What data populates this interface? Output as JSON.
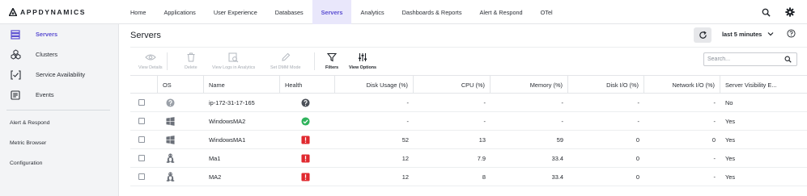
{
  "brand": {
    "name": "APPDYNAMICS"
  },
  "nav": {
    "items": [
      {
        "label": "Home",
        "active": false
      },
      {
        "label": "Applications",
        "active": false
      },
      {
        "label": "User Experience",
        "active": false
      },
      {
        "label": "Databases",
        "active": false
      },
      {
        "label": "Servers",
        "active": true
      },
      {
        "label": "Analytics",
        "active": false
      },
      {
        "label": "Dashboards & Reports",
        "active": false
      },
      {
        "label": "Alert & Respond",
        "active": false
      },
      {
        "label": "OTel",
        "active": false
      }
    ],
    "right_icons": [
      "search-icon",
      "gear-icon"
    ]
  },
  "sidebar": {
    "items": [
      {
        "label": "Servers",
        "icon": "server-stack-icon",
        "active": true
      },
      {
        "label": "Clusters",
        "icon": "cluster-icon",
        "active": false
      },
      {
        "label": "Service Availability",
        "icon": "service-check-icon",
        "active": false
      },
      {
        "label": "Events",
        "icon": "events-icon",
        "active": false
      }
    ],
    "links": [
      {
        "label": "Alert & Respond"
      },
      {
        "label": "Metric Browser"
      },
      {
        "label": "Configuration"
      }
    ]
  },
  "header": {
    "title": "Servers",
    "time_range": "last 5 minutes",
    "accent": "#5b4ed1"
  },
  "toolbar": {
    "tools": [
      {
        "label": "View Details",
        "icon": "eye-icon",
        "enabled": false
      },
      {
        "label": "Delete",
        "icon": "trash-icon",
        "enabled": false
      },
      {
        "label": "View Logs in Analytics",
        "icon": "logs-search-icon",
        "enabled": false
      },
      {
        "label": "Set DMM Mode",
        "icon": "pencil-icon",
        "enabled": false
      },
      {
        "label": "Filters",
        "icon": "filter-icon",
        "enabled": true
      },
      {
        "label": "View Options",
        "icon": "sliders-icon",
        "enabled": true
      }
    ],
    "search_placeholder": "Search..."
  },
  "table": {
    "columns": [
      "OS",
      "Name",
      "Health",
      "Disk Usage (%)",
      "CPU (%)",
      "Memory (%)",
      "Disk I/O (%)",
      "Network I/O (%)",
      "Server Visibility E..."
    ],
    "rows": [
      {
        "os": "unknown-os-icon",
        "name": "ip-172-31-17-165",
        "health": "unknown",
        "disk_usage": "-",
        "cpu": "-",
        "memory": "-",
        "disk_io": "-",
        "network_io": "-",
        "server_visibility": "No"
      },
      {
        "os": "windows-icon",
        "name": "WindowsMA2",
        "health": "normal",
        "disk_usage": "-",
        "cpu": "-",
        "memory": "-",
        "disk_io": "-",
        "network_io": "-",
        "server_visibility": "Yes"
      },
      {
        "os": "windows-icon",
        "name": "WindowsMA1",
        "health": "critical",
        "disk_usage": "52",
        "cpu": "13",
        "memory": "59",
        "disk_io": "0",
        "network_io": "0",
        "server_visibility": "Yes"
      },
      {
        "os": "linux-icon",
        "name": "Ma1",
        "health": "critical",
        "disk_usage": "12",
        "cpu": "7.9",
        "memory": "33.4",
        "disk_io": "0",
        "network_io": "-",
        "server_visibility": "Yes"
      },
      {
        "os": "linux-icon",
        "name": "MA2",
        "health": "critical",
        "disk_usage": "12",
        "cpu": "8",
        "memory": "33.4",
        "disk_io": "0",
        "network_io": "-",
        "server_visibility": "Yes"
      }
    ]
  },
  "status_colors": {
    "normal": "#2fb35c",
    "critical": "#e0292f",
    "unknown": "#4a4f57"
  }
}
